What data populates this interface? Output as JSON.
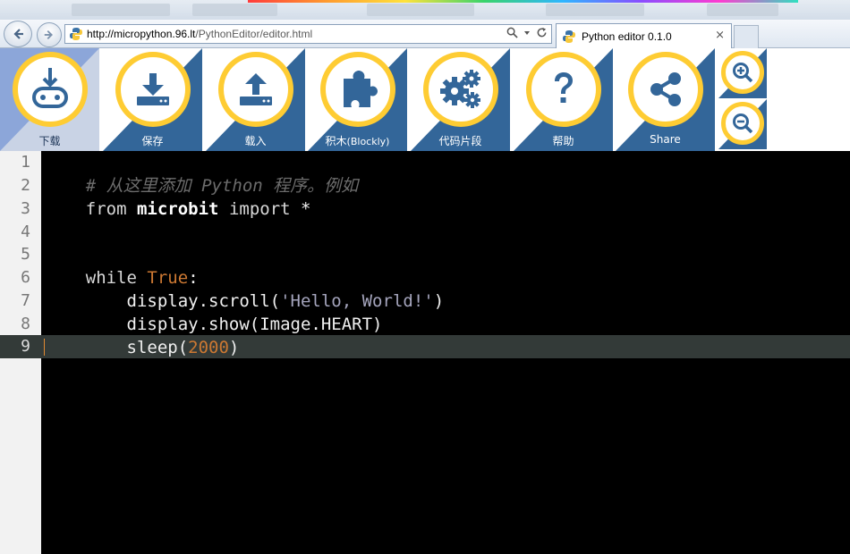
{
  "browser": {
    "address": {
      "domain": "http://micropython.96.lt",
      "path": "/PythonEditor/editor.html"
    },
    "tab": {
      "title": "Python editor 0.1.0",
      "close": "×"
    }
  },
  "toolbar": {
    "buttons": [
      {
        "id": "download",
        "label": "下载",
        "icon": "microbit-download-icon"
      },
      {
        "id": "save",
        "label": "保存",
        "icon": "download-tray-icon"
      },
      {
        "id": "load",
        "label": "载入",
        "icon": "upload-tray-icon"
      },
      {
        "id": "blocks",
        "label": "积木",
        "label_suffix": "(Blockly)",
        "icon": "puzzle-icon"
      },
      {
        "id": "snippets",
        "label": "代码片段",
        "icon": "gears-icon"
      },
      {
        "id": "help",
        "label": "帮助",
        "icon": "question-icon"
      },
      {
        "id": "share",
        "label": "Share",
        "icon": "share-icon"
      }
    ],
    "zoom": [
      {
        "id": "zoom-in",
        "icon": "zoom-in-icon"
      },
      {
        "id": "zoom-out",
        "icon": "zoom-out-icon"
      }
    ]
  },
  "editor": {
    "line_numbers": [
      "1",
      "2",
      "3",
      "4",
      "5",
      "6",
      "7",
      "8",
      "9"
    ],
    "active_line": "9",
    "lines": {
      "l1": "# 从这里添加 Python 程序。例如",
      "l2_kw1": "from",
      "l2_mod": "microbit",
      "l2_kw2": "import",
      "l2_star": "*",
      "l5_kw": "while",
      "l5_true": "True",
      "l5_colon": ":",
      "l6_a": "    display.scroll(",
      "l6_str": "'Hello, World!'",
      "l6_b": ")",
      "l7": "    display.show(Image.HEART)",
      "l8_a": "    sleep(",
      "l8_num": "2000",
      "l8_b": ")"
    }
  },
  "colors": {
    "toolbar_blue": "#336699",
    "ring_yellow": "#fecc33",
    "editor_bg": "#000000",
    "gutter_bg": "#f2f2f2",
    "active_line_bg": "#333a38",
    "keyword_orange": "#cc7832"
  }
}
